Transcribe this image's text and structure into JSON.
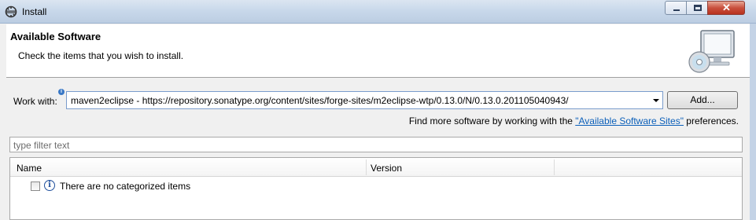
{
  "window": {
    "title": "Install",
    "controls": {
      "minimize": "minimize",
      "maximize": "maximize",
      "close": "✕"
    }
  },
  "banner": {
    "title": "Available Software",
    "description": "Check the items that you wish to install.",
    "icon": "software-install-icon"
  },
  "work_with": {
    "label": "Work with:",
    "value": "maven2eclipse - https://repository.sonatype.org/content/sites/forge-sites/m2eclipse-wtp/0.13.0/N/0.13.0.201105040943/",
    "add_button": "Add..."
  },
  "more_software": {
    "prefix": "Find more software by working with the ",
    "link": "\"Available Software Sites\"",
    "suffix": " preferences."
  },
  "filter": {
    "placeholder": "type filter text"
  },
  "table": {
    "columns": [
      "Name",
      "Version"
    ],
    "rows": [
      {
        "label": "There are no categorized items",
        "checked": false
      }
    ]
  }
}
